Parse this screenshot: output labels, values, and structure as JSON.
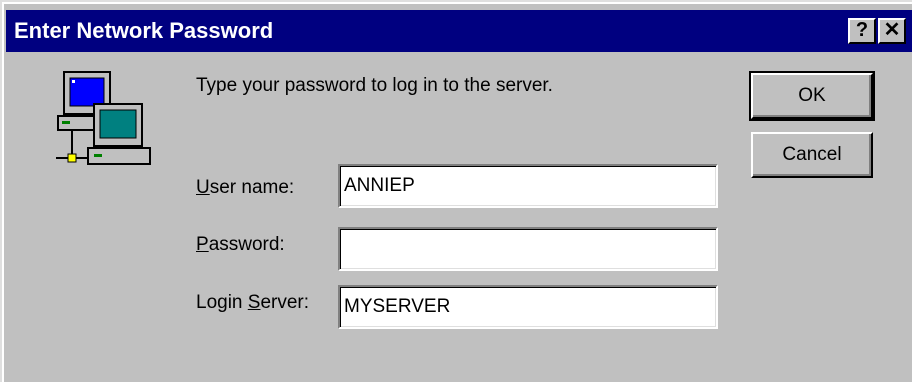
{
  "window": {
    "title": "Enter Network Password",
    "help_glyph": "?",
    "close_glyph": "✕"
  },
  "dialog": {
    "icon": "network-computers-icon",
    "prompt": "Type your password to log in to the server.",
    "fields": {
      "user_name": {
        "label_ul": "U",
        "label_rest": "ser name:",
        "value": "ANNIEP"
      },
      "password": {
        "label_ul": "P",
        "label_rest": "assword:",
        "value": ""
      },
      "login_server": {
        "label_pre": "Login ",
        "label_ul": "S",
        "label_rest": "erver:",
        "value": "MYSERVER"
      }
    },
    "buttons": {
      "ok": "OK",
      "cancel": "Cancel"
    }
  },
  "colors": {
    "titlebar": "#000080",
    "face": "#c0c0c0"
  }
}
